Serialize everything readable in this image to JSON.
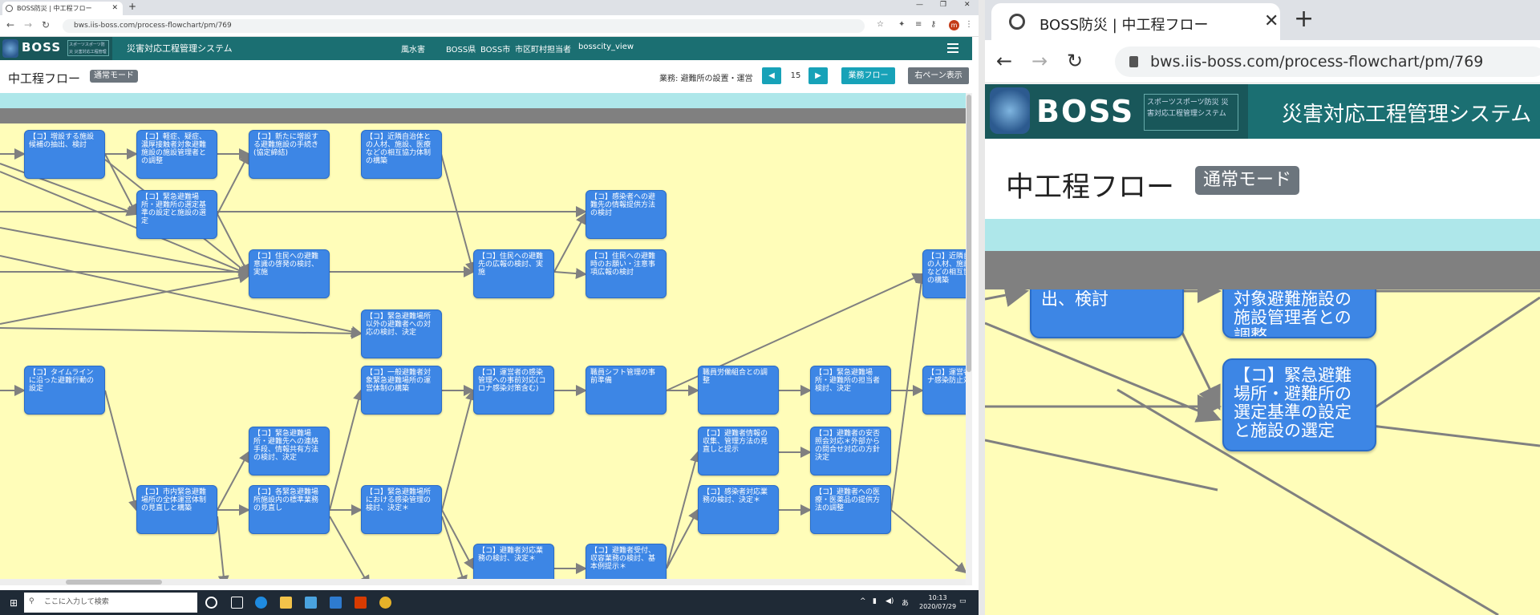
{
  "browser": {
    "tab_title": "BOSS防災 | 中工程フロー",
    "url": "bws.iis-boss.com/process-flowchart/pm/769",
    "avatar_letter": "m"
  },
  "header": {
    "logo": "BOSS",
    "logo_sub": "スポーツスポーツ防災 災害対応工程管理システム",
    "system_name": "災害対応工程管理システム",
    "disaster": "風水害",
    "prefecture": "BOSS県",
    "city": "BOSS市",
    "role": "市区町村担当者",
    "user": "bosscity_view"
  },
  "page": {
    "title": "中工程フロー",
    "mode_badge": "通常モード",
    "business_label": "業務: 避難所の設置・運営",
    "page_number": "15",
    "prev": "◀",
    "next": "▶",
    "flow_button": "業務フロー",
    "right_pane_button": "右ペーン表示"
  },
  "nodes": [
    "【コ】増設する施設候補の抽出、検討",
    "【コ】軽症、疑症、濃厚接触者対象避難施設の施設管理者との調整",
    "【コ】新たに増設する避難施設の手続き(協定締結)",
    "【コ】近隣自治体との人材、施設、医療などの相互協力体制の構築",
    "【コ】緊急避難場所・避難所の選定基準の設定と施設の選定",
    "【コ】感染者への避難先の情報提供方法の検討",
    "【コ】住民への避難意識の啓発の検討、実施",
    "【コ】住民への避難先の広報の検討、実施",
    "【コ】住民への避難時のお願い・注意事項広報の検討",
    "【コ】近隣自治体との人材、施設、医療などの相互協力体制の構築",
    "【コ】緊急避難場所以外の避難者への対応の検討、決定",
    "【コ】タイムラインに沿った避難行動の設定",
    "【コ】一般避難者対象緊急避難場所の運営体制の構築",
    "【コ】運営者の感染管理への事前対応(コロナ感染対策含む)",
    "職員シフト管理の事前準備",
    "職員労働組合との調整",
    "【コ】緊急避難場所・避難所の担当者検討、決定",
    "【コ】運営者のコロナ感染防止対策",
    "【コ】緊急避難場所・避難先への連絡手段、情報共有方法の検討、決定",
    "【コ】避難者情報の収集、管理方法の見直しと提示",
    "【コ】避難者の安否照会対応＊外部からの問合せ対応の方針決定",
    "【コ】市内緊急避難場所の全体運営体制の見直しと構築",
    "【コ】各緊急避難場所施設内の標準業務の見直し",
    "【コ】緊急避難場所における感染管理の検討、決定＊",
    "【コ】感染者対応業務の検討、決定＊",
    "【コ】避難者への医療・医薬品の提供方法の調整",
    "【コ】避難者対応業務の検討、決定＊",
    "【コ】避難者受付、収容業務の検討、基本例提示＊"
  ],
  "taskbar": {
    "search_placeholder": "ここに入力して検索",
    "time": "10:13",
    "date": "2020/07/29"
  }
}
